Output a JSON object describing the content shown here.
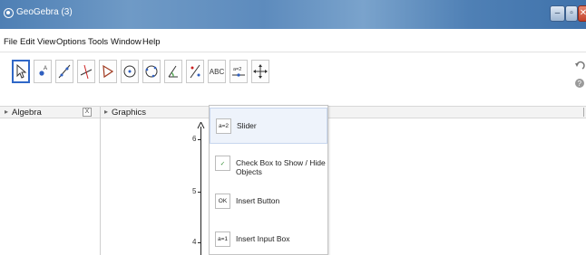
{
  "window": {
    "title": "GeoGebra (3)",
    "buttons": {
      "minimize": "–",
      "maximize": "▫",
      "close": "✕"
    }
  },
  "menu": [
    "File",
    "Edit",
    "View",
    "Options",
    "Tools",
    "Window",
    "Help"
  ],
  "toolbar": {
    "tools": [
      "move-tool",
      "point-tool",
      "line-tool",
      "perpendicular-line-tool",
      "polygon-tool",
      "circle-center-point-tool",
      "circle-three-points-tool",
      "angle-tool",
      "reflect-tool",
      "text-tool",
      "slider-tool",
      "move-graphics-view-tool"
    ],
    "text_tool_label": "ABC",
    "slider_tool_label": "a=2"
  },
  "views": {
    "algebra_label": "Algebra",
    "graphics_label": "Graphics",
    "close_view": "X"
  },
  "axis": {
    "y_ticks": [
      "6",
      "5",
      "4"
    ]
  },
  "dropdown": {
    "items": [
      {
        "icon": "slider-icon",
        "icon_text": "a=2",
        "label": "Slider"
      },
      {
        "icon": "checkbox-icon",
        "icon_text": "✓",
        "label": "Check Box to Show / Hide Objects"
      },
      {
        "icon": "button-icon",
        "icon_text": "OK",
        "label": "Insert Button"
      },
      {
        "icon": "input-box-icon",
        "icon_text": "a=1",
        "label": "Insert Input Box"
      }
    ]
  }
}
